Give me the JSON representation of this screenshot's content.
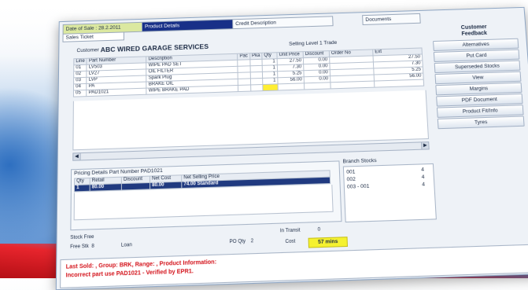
{
  "tabs": {
    "date": "Date of Sale : 28.2.2011",
    "active": "Product Details",
    "third": "Credit Description",
    "fourth": "Documents",
    "sub": "Sales Ticket"
  },
  "sidebar": {
    "title_line1": "Customer",
    "title_line2": "Feedback",
    "buttons": [
      "Alternatives",
      "Put Card",
      "Superseded Stocks",
      "View",
      "Margins",
      "PDF Document",
      "Product Fit/Info",
      "Tyres"
    ]
  },
  "header": {
    "customer_label": "Customer",
    "customer_value": "ABC WIRED GARAGE SERVICES",
    "sell_level": "Selling Level  1  Trade"
  },
  "order_grid": {
    "columns": [
      "Line",
      "Part Number",
      "Description",
      "Pac",
      "Pka",
      "Qty",
      "Unit Price",
      "Discount",
      "Order No",
      "Ext"
    ],
    "rows": [
      {
        "line": "01",
        "part": "LV503",
        "desc": "WIPE PAD SET",
        "pac": "",
        "pka": "",
        "qty": "1",
        "price": "27.50",
        "disc": "0.00",
        "order": "",
        "ext": "27.50",
        "yellow": false
      },
      {
        "line": "02",
        "part": "LV27",
        "desc": "OIL FILTER",
        "pac": "",
        "pka": "",
        "qty": "1",
        "price": "7.30",
        "disc": "0.00",
        "order": "",
        "ext": "7.30",
        "yellow": false
      },
      {
        "line": "03",
        "part": "LVP",
        "desc": "Spark Plug",
        "pac": "",
        "pka": "",
        "qty": "1",
        "price": "5.25",
        "disc": "0.00",
        "order": "",
        "ext": "5.25",
        "yellow": false
      },
      {
        "line": "04",
        "part": "PA",
        "desc": "BRAKE OIL",
        "pac": "",
        "pka": "",
        "qty": "1",
        "price": "56.00",
        "disc": "0.00",
        "order": "",
        "ext": "56.00",
        "yellow": false
      },
      {
        "line": "05",
        "part": "PAD1021",
        "desc": "WIPE BRAKE PAD",
        "pac": "",
        "pka": "",
        "qty": "",
        "price": "",
        "disc": "",
        "order": "",
        "ext": "",
        "yellow": true
      }
    ]
  },
  "pricing": {
    "title": "Pricing Details  Part Number PAD1021",
    "columns": [
      "Qty",
      "Retail",
      "Discount",
      "Net Cost",
      "Net Selling Price"
    ],
    "row": {
      "qty": "1",
      "retail": "80.00",
      "disc": "",
      "net": "80.00",
      "sell": "74.00 Standard"
    }
  },
  "branch": {
    "title": "Branch Stocks",
    "rows": [
      {
        "name": "001",
        "qty": "4"
      },
      {
        "name": "002",
        "qty": "4"
      },
      {
        "name": "003 - 001",
        "qty": "4"
      }
    ]
  },
  "stock": {
    "label": "Stock Free",
    "free_qty_label": "Free Stk",
    "free_qty": "8",
    "loan_label": "Loan",
    "po_label": "PO Qty",
    "po_qty": "2",
    "transit_label": "In Transit",
    "transit_qty": "0",
    "cost_label": "Cost",
    "cost_value": "57 mins"
  },
  "info": {
    "line1": "Last Sold: , Group: BRK, Range: , Product Information:",
    "line2": "Incorrect part use PAD1021 - Verified by EPR1."
  }
}
